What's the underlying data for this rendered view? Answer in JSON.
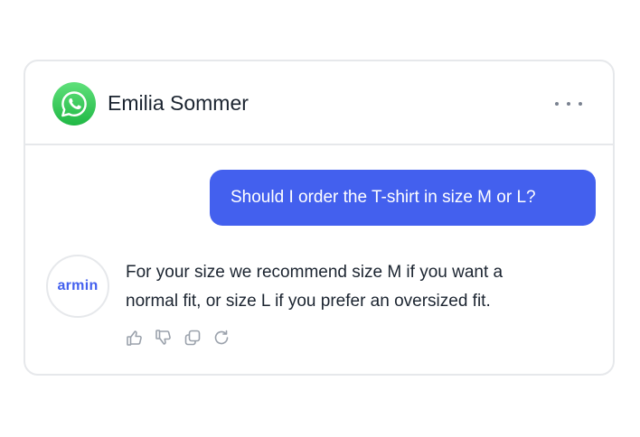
{
  "header": {
    "channel_icon": "whatsapp-icon",
    "contact_name": "Emilia Sommer",
    "menu_icon": "more-horizontal-icon"
  },
  "messages": {
    "user": {
      "text": "Should I order the T-shirt in size M or L?"
    },
    "bot": {
      "avatar_label": "armin",
      "lines": [
        "For your size we recommend size M if you want a",
        "normal fit, or size L if you prefer an oversized fit."
      ],
      "actions": [
        "thumbs-up-icon",
        "thumbs-down-icon",
        "copy-icon",
        "regenerate-icon"
      ]
    }
  },
  "colors": {
    "accent": "#4360ee",
    "whatsapp_green": "#25d366",
    "text": "#1b2430",
    "border": "#e6e8eb",
    "icon_gray": "#9aa1ab"
  }
}
